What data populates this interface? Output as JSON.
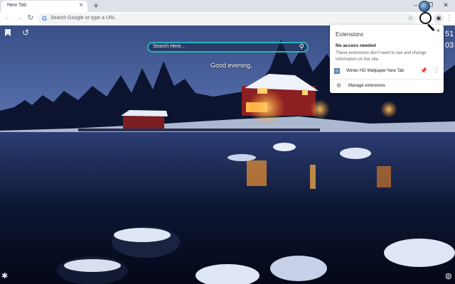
{
  "browser": {
    "tab": {
      "title": "New Tab",
      "close_glyph": "×"
    },
    "new_tab_glyph": "+",
    "window_controls": [
      "–",
      "❐",
      "✕"
    ],
    "toolbar": {
      "back_glyph": "←",
      "forward_glyph": "→",
      "reload_glyph": "↻",
      "omnibox_placeholder": "Search Google or type a URL",
      "google_glyph": "G",
      "star_glyph": "☆",
      "extensions_glyph": "✱",
      "menu_glyph": "⋮"
    }
  },
  "newtab": {
    "search_placeholder": "Search Here...",
    "search_glyph": "⚲",
    "greeting": "Good evening,",
    "history_glyph": "↺",
    "settings_glyph": "✱",
    "globe_glyph": "◍",
    "clock_peek_top": "51",
    "clock_peek_bottom": "03"
  },
  "extensions_popup": {
    "title": "Extensions",
    "close_glyph": "×",
    "subtitle": "No access needed",
    "description": "These extensions don't need to see and change information on this site.",
    "items": [
      {
        "name": "Winter HD Wallpaper New Tab",
        "pinned": true,
        "pin_glyph": "📌",
        "menu_glyph": "⋮"
      }
    ],
    "manage_label": "Manage extensions",
    "manage_glyph": "⚙"
  },
  "colors": {
    "search_border": "#2bb3c0",
    "pin_color": "#1a73e8",
    "house_red": "#8b1f22"
  }
}
